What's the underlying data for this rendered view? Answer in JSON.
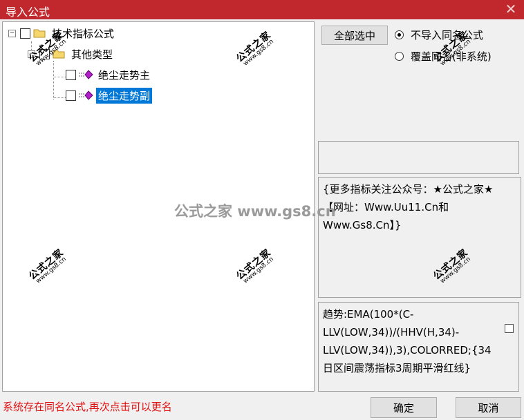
{
  "window": {
    "title": "导入公式",
    "close_glyph": "✕"
  },
  "tree": {
    "items": [
      {
        "label": "技术指标公式",
        "expander": "−"
      },
      {
        "label": "其他类型",
        "expander": "−"
      },
      {
        "label": "绝尘走势主"
      },
      {
        "label": "绝尘走势副",
        "selected": true
      }
    ]
  },
  "options": {
    "select_all_label": "全部选中",
    "radio_no_import": "不导入同名公式",
    "radio_overwrite": "覆盖同名(非系统)",
    "selected_radio": "no_import"
  },
  "info_text": "{更多指标关注公众号：★公式之家★ 【网址：Www.Uu11.Cn和Www.Gs8.Cn】}",
  "formula_text": "趋势:EMA(100*(C-LLV(LOW,34))/(HHV(H,34)-LLV(LOW,34)),3),COLORRED;{34日区间震荡指标3周期平滑红线}",
  "status_text": "系统存在同名公式,再次点击可以更名",
  "buttons": {
    "ok": "确定",
    "cancel": "取消"
  },
  "watermark": {
    "big": "公式之家",
    "small": "www.gs8.cn",
    "center": "公式之家 www.gs8.cn"
  }
}
